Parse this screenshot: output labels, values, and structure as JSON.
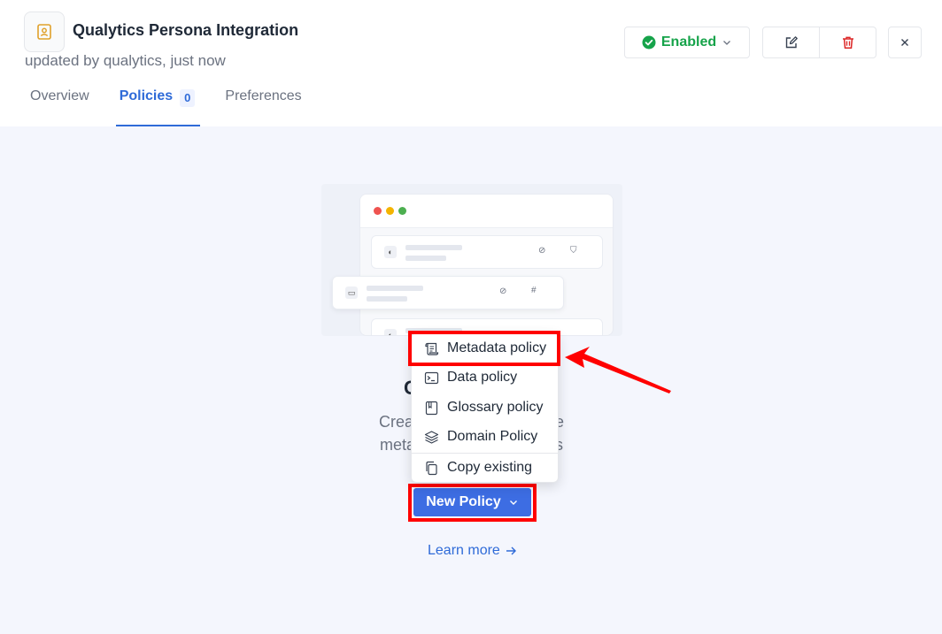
{
  "header": {
    "title": "Qualytics Persona Integration",
    "subtitle": "updated by qualytics, just now",
    "status_label": "Enabled",
    "colors": {
      "status": "#16a34a",
      "accent": "#2f6bd8",
      "delete": "#dc2626",
      "app_icon": "#e0a12b"
    }
  },
  "tabs": [
    {
      "label": "Overview"
    },
    {
      "label": "Policies",
      "count": "0",
      "active": true
    },
    {
      "label": "Preferences"
    }
  ],
  "empty_state": {
    "title_visible": "C",
    "desc_line1_left": "Crea",
    "desc_line1_right": "e",
    "desc_line2_left": "meta",
    "desc_line2_right": "s",
    "button_label": "New Policy",
    "learn_more": "Learn more"
  },
  "menu": {
    "items": [
      {
        "label": "Metadata policy",
        "icon": "scroll-icon"
      },
      {
        "label": "Data policy",
        "icon": "terminal-icon"
      },
      {
        "label": "Glossary policy",
        "icon": "book-icon"
      },
      {
        "label": "Domain Policy",
        "icon": "layers-icon"
      },
      {
        "label": "Copy existing",
        "icon": "copy-icon"
      }
    ]
  },
  "annotation": {
    "highlight_color": "#ff0000"
  }
}
